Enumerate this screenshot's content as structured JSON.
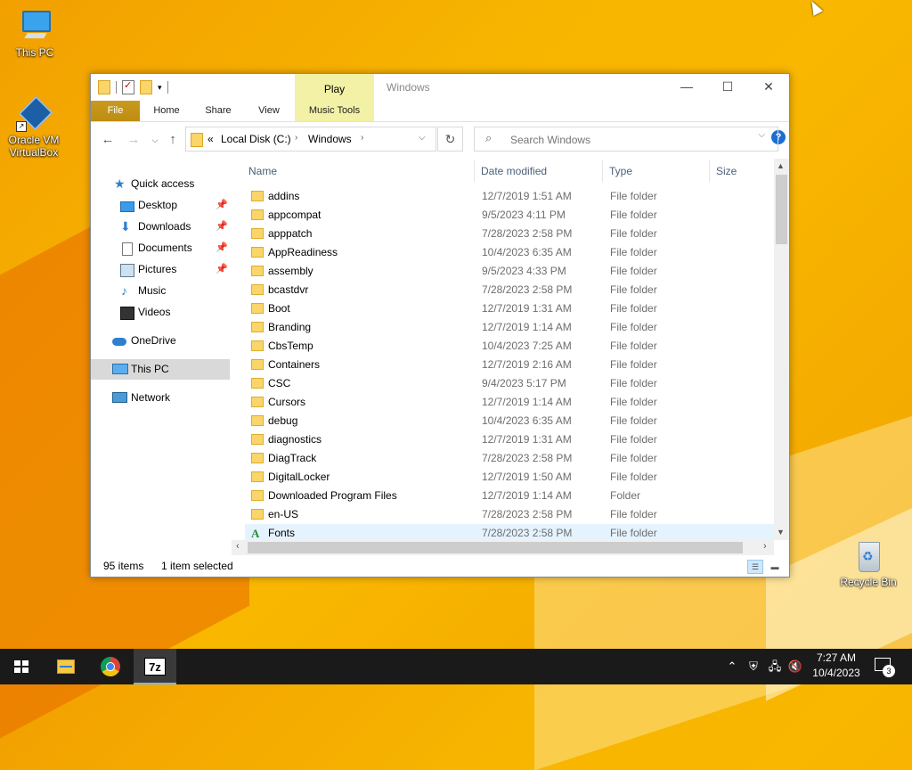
{
  "desktop": {
    "icons": {
      "this_pc": "This PC",
      "oracle_vm": "Oracle VM VirtualBox",
      "recycle_bin": "Recycle Bin"
    },
    "accent": "#f7b500"
  },
  "window": {
    "title": "Windows",
    "contextual_tab": "Play",
    "ribbon_tabs": {
      "file": "File",
      "home": "Home",
      "share": "Share",
      "view": "View",
      "music_tools": "Music Tools"
    },
    "address": {
      "chevron": "«",
      "drive": "Local Disk (C:)",
      "folder": "Windows"
    },
    "search": {
      "placeholder": "Search Windows"
    },
    "nav_pane": {
      "quick_access": "Quick access",
      "desktop": "Desktop",
      "downloads": "Downloads",
      "documents": "Documents",
      "pictures": "Pictures",
      "music": "Music",
      "videos": "Videos",
      "onedrive": "OneDrive",
      "this_pc": "This PC",
      "network": "Network"
    },
    "columns": {
      "name": "Name",
      "date": "Date modified",
      "type": "Type",
      "size": "Size"
    },
    "files": [
      {
        "name": "addins",
        "date": "12/7/2019 1:51 AM",
        "type": "File folder"
      },
      {
        "name": "appcompat",
        "date": "9/5/2023 4:11 PM",
        "type": "File folder"
      },
      {
        "name": "apppatch",
        "date": "7/28/2023 2:58 PM",
        "type": "File folder"
      },
      {
        "name": "AppReadiness",
        "date": "10/4/2023 6:35 AM",
        "type": "File folder"
      },
      {
        "name": "assembly",
        "date": "9/5/2023 4:33 PM",
        "type": "File folder"
      },
      {
        "name": "bcastdvr",
        "date": "7/28/2023 2:58 PM",
        "type": "File folder"
      },
      {
        "name": "Boot",
        "date": "12/7/2019 1:31 AM",
        "type": "File folder"
      },
      {
        "name": "Branding",
        "date": "12/7/2019 1:14 AM",
        "type": "File folder"
      },
      {
        "name": "CbsTemp",
        "date": "10/4/2023 7:25 AM",
        "type": "File folder"
      },
      {
        "name": "Containers",
        "date": "12/7/2019 2:16 AM",
        "type": "File folder"
      },
      {
        "name": "CSC",
        "date": "9/4/2023 5:17 PM",
        "type": "File folder"
      },
      {
        "name": "Cursors",
        "date": "12/7/2019 1:14 AM",
        "type": "File folder"
      },
      {
        "name": "debug",
        "date": "10/4/2023 6:35 AM",
        "type": "File folder"
      },
      {
        "name": "diagnostics",
        "date": "12/7/2019 1:31 AM",
        "type": "File folder"
      },
      {
        "name": "DiagTrack",
        "date": "7/28/2023 2:58 PM",
        "type": "File folder"
      },
      {
        "name": "DigitalLocker",
        "date": "12/7/2019 1:50 AM",
        "type": "File folder"
      },
      {
        "name": "Downloaded Program Files",
        "date": "12/7/2019 1:14 AM",
        "type": "Folder"
      },
      {
        "name": "en-US",
        "date": "7/28/2023 2:58 PM",
        "type": "File folder"
      },
      {
        "name": "Fonts",
        "date": "7/28/2023 2:58 PM",
        "type": "File folder"
      }
    ],
    "status": {
      "count": "95 items",
      "selection": "1 item selected"
    }
  },
  "taskbar": {
    "time": "7:27 AM",
    "date": "10/4/2023",
    "notification_count": "3",
    "seven_zip_label": "7z"
  }
}
